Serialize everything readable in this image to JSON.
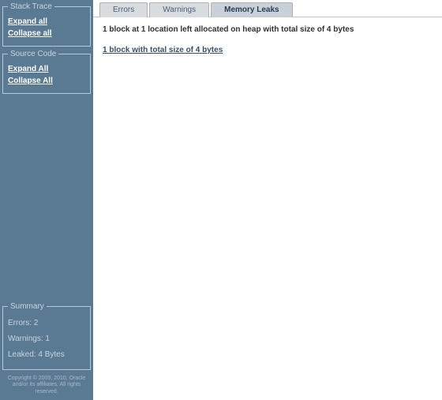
{
  "sidebar": {
    "stackTrace": {
      "legend": "Stack Trace",
      "expand": "Expand all",
      "collapse": "Collapse all"
    },
    "sourceCode": {
      "legend": "Source Code",
      "expand": "Expand All",
      "collapse": "Collapse All"
    },
    "summary": {
      "legend": "Summary",
      "errors": "Errors: 2",
      "warnings": "Warnings: 1",
      "leaked": "Leaked: 4 Bytes"
    },
    "copyright": "Copyright © 2009, 2010, Oracle and/or its affiliates. All rights reserved."
  },
  "tabs": {
    "errors": "Errors",
    "warnings": "Warnings",
    "memoryLeaks": "Memory Leaks"
  },
  "content": {
    "heading": "1 block at 1 location left allocated on heap with total size of 4 bytes",
    "link": "1 block with total size of 4 bytes"
  }
}
